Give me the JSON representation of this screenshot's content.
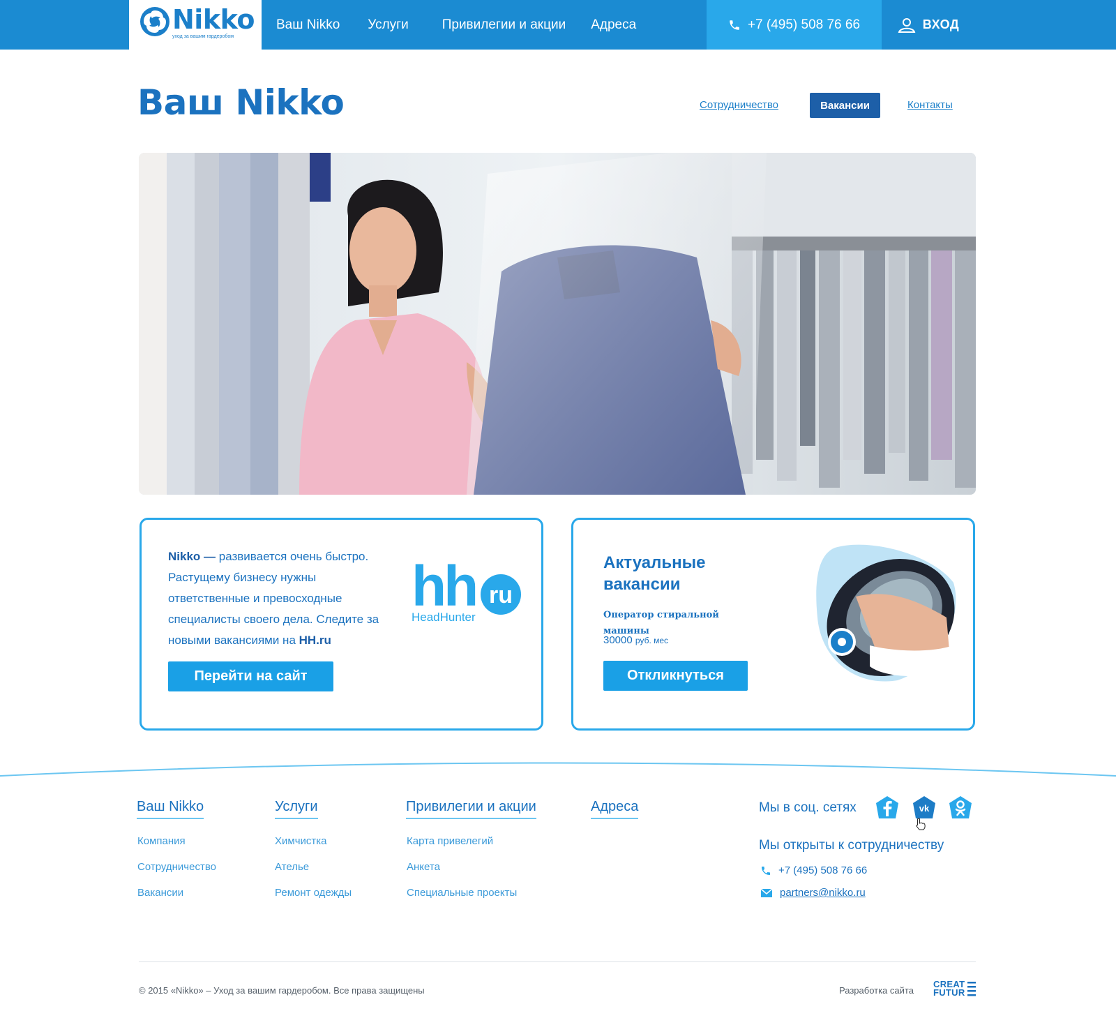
{
  "header": {
    "logo_text": "Nikko",
    "logo_tagline": "уход за вашим гардеробом",
    "nav": [
      "Ваш Nikko",
      "Услуги",
      "Привилегии и акции",
      "Адреса"
    ],
    "phone": "+7 (495) 508 76 66",
    "login": "ВХОД"
  },
  "page": {
    "title": "Ваш Nikko",
    "subnav": {
      "link1": "Сотрудничество",
      "active": "Вакансии",
      "link3": "Контакты"
    }
  },
  "card_hh": {
    "brand": "Nikko —",
    "text_1": " развивается очень быстро. Растущему бизнесу нужны ответственные и превосходные специалисты своего дела. Следите за новыми вакансиями на ",
    "link": "HH.ru",
    "button": "Перейти на сайт",
    "logo_main": "hh",
    "logo_badge": "ru",
    "logo_caption": "HeadHunter"
  },
  "card_vacancies": {
    "title": "Актуальные вакансии",
    "position": "Оператор стиральной машины",
    "salary": "30000",
    "salary_unit": "руб. мес",
    "button": "Откликнуться"
  },
  "footer": {
    "columns": [
      {
        "title": "Ваш Nikko",
        "links": [
          "Компания",
          "Сотрудничество",
          "Вакансии"
        ]
      },
      {
        "title": "Услуги",
        "links": [
          "Химчистка",
          "Ателье",
          "Ремонт одежды"
        ]
      },
      {
        "title": "Привилегии и акции",
        "links": [
          "Карта привелегий",
          "Анкета",
          "Специальные проекты"
        ]
      },
      {
        "title": "Адреса",
        "links": []
      }
    ],
    "social_title": "Мы в соц. сетях",
    "social": [
      "facebook-icon",
      "vk-icon",
      "odnoklassniki-icon"
    ],
    "coop_title": "Мы открыты к сотрудничеству",
    "phone": "+7 (495) 508 76 66",
    "email": "partners@nikko.ru",
    "copyright": "©  2015  «Nikko» – Уход за вашим гардеробом. Все права защищены",
    "dev_label": "Разработка сайта",
    "dev_logo_1": "CREAT",
    "dev_logo_2": "FUTUR"
  },
  "colors": {
    "header_bg": "#1b8bd2",
    "accent": "#29a8ea",
    "button": "#1aa0e6",
    "heading": "#1b72bf",
    "active_tab": "#1d5fa8"
  }
}
